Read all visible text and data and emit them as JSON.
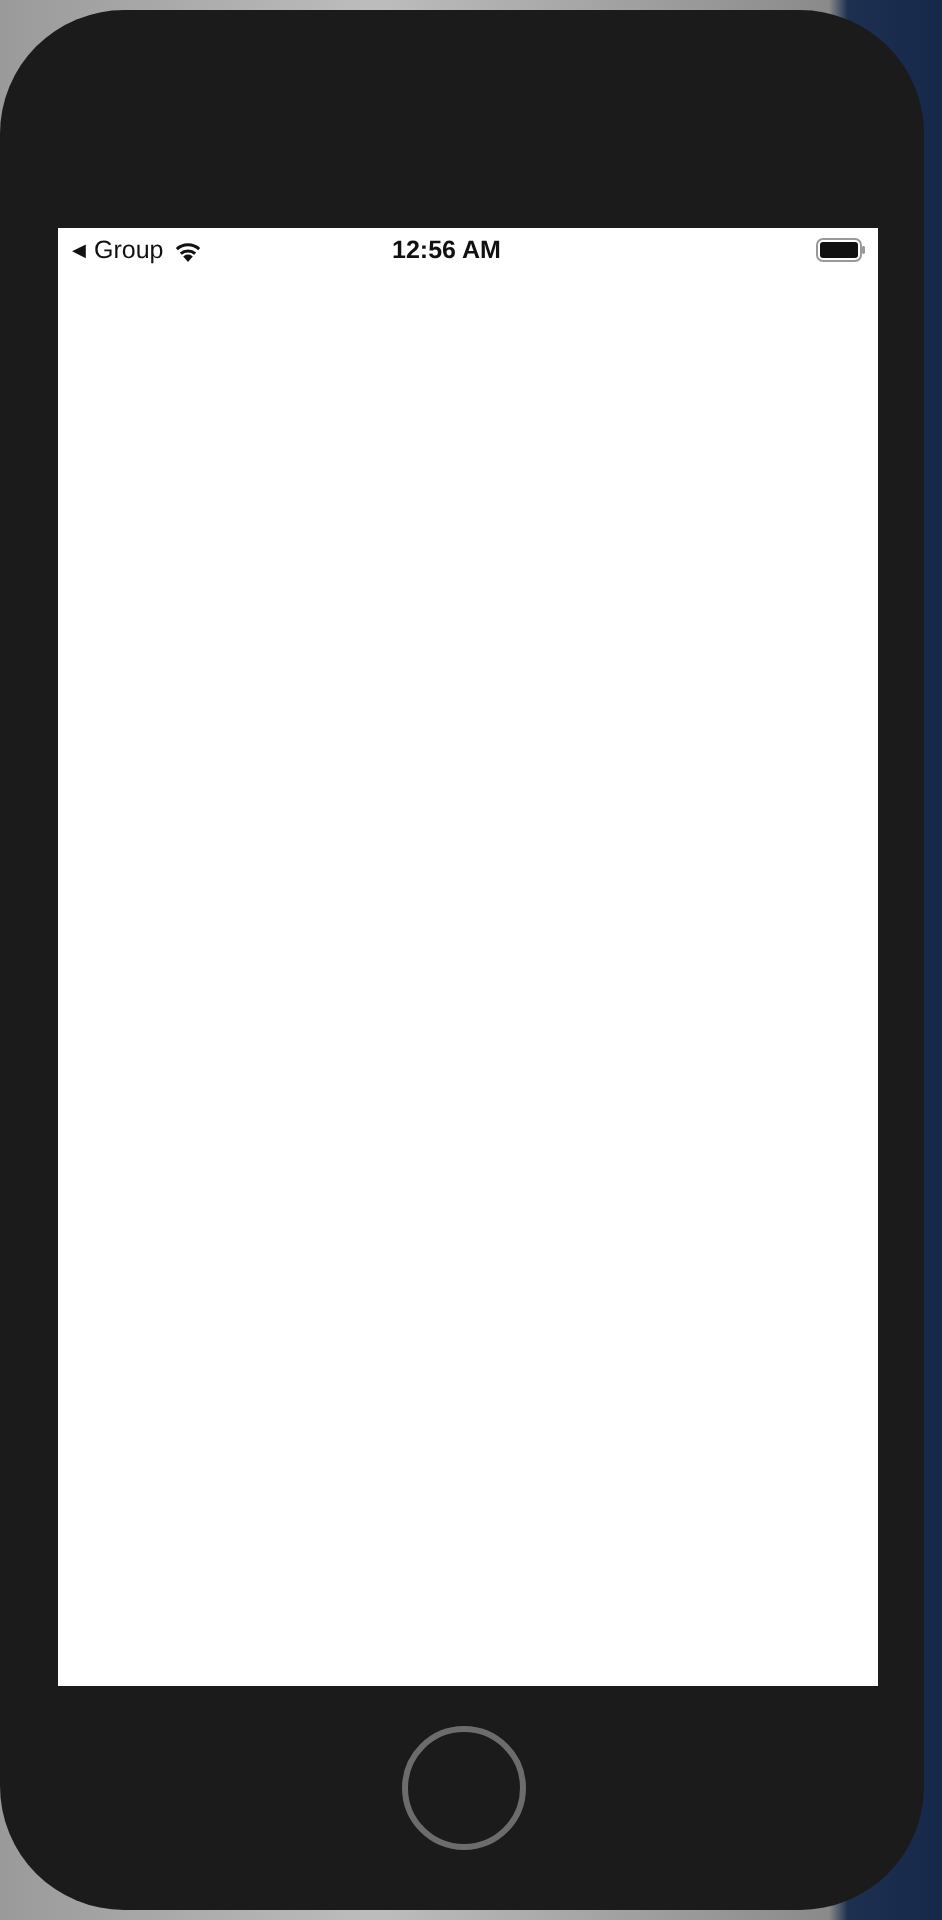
{
  "status_bar": {
    "back_arrow": "◀",
    "back_label": "Group",
    "time": "12:56 AM"
  }
}
